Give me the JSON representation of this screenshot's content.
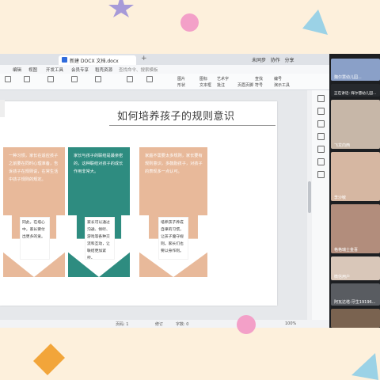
{
  "window": {
    "tab_title": "新建 DOCX 文档.docx",
    "new_tab": "+",
    "sync_label": "未同步",
    "collab_label": "协作",
    "share_label": "分享"
  },
  "menu": {
    "items": [
      "编辑",
      "视图",
      "开发工具",
      "会员专享",
      "稻壳资源"
    ],
    "search_placeholder": "查找命令、搜索模板"
  },
  "ribbon": {
    "labels": [
      "图片",
      "形状",
      "图标",
      "文本框",
      "艺术字",
      "批注",
      "页眉页脚",
      "查找",
      "符号",
      "编号",
      "演示工具"
    ]
  },
  "slide": {
    "title": "如何培养孩子的规则意识",
    "cards": [
      {
        "color": "#e8b99a",
        "text": "一种习惯，家长在适应孩子之前要在同时心理准备，告诉孩子在规则说，在常生活中孩子规则的规定。",
        "box": "同此，在培心中，家长要付出更多的爱。"
      },
      {
        "color": "#2e8c80",
        "text": "家长与孩子的联结是最亲密的，这种联结对孩子的成长作用非常大。",
        "box": "家长可以通过沟通、倾听、游戏等各种交流和互动，让联结更加紧密。"
      },
      {
        "color": "#e8b99a",
        "text": "家庭不需要太多规则，家长要有规则意识，多鼓励孩子，对孩子的表现多一点认可。",
        "box": "培养孩子养成自律的习惯，让孩子遵守规则。家长们也要以身作则。"
      }
    ]
  },
  "status": {
    "page": "页码: 1",
    "revise": "修订",
    "words": "字数: 0",
    "zoom": "100%"
  },
  "participants": [
    {
      "name": "魏尔慧幼儿园...",
      "color": "#8aa0c8"
    },
    {
      "name": "正在讲话: 辉尔慧幼儿园...",
      "color": "#26292d"
    },
    {
      "name": "飞龙向西",
      "color": "#c7b7a8"
    },
    {
      "name": "李沙敏",
      "color": "#d6b7a2"
    },
    {
      "name": "格格瑞士金喜",
      "color": "#b28d7c"
    },
    {
      "name": "微信用户",
      "color": "#d9c7b9"
    },
    {
      "name": "阿瓦达塔-牙生19196...",
      "color": "#595c61"
    },
    {
      "name": "",
      "color": "#7a6350"
    }
  ],
  "colors": {
    "accent_teal": "#2e8c80",
    "accent_peach": "#e8b99a",
    "background": "#fdf0dc"
  }
}
